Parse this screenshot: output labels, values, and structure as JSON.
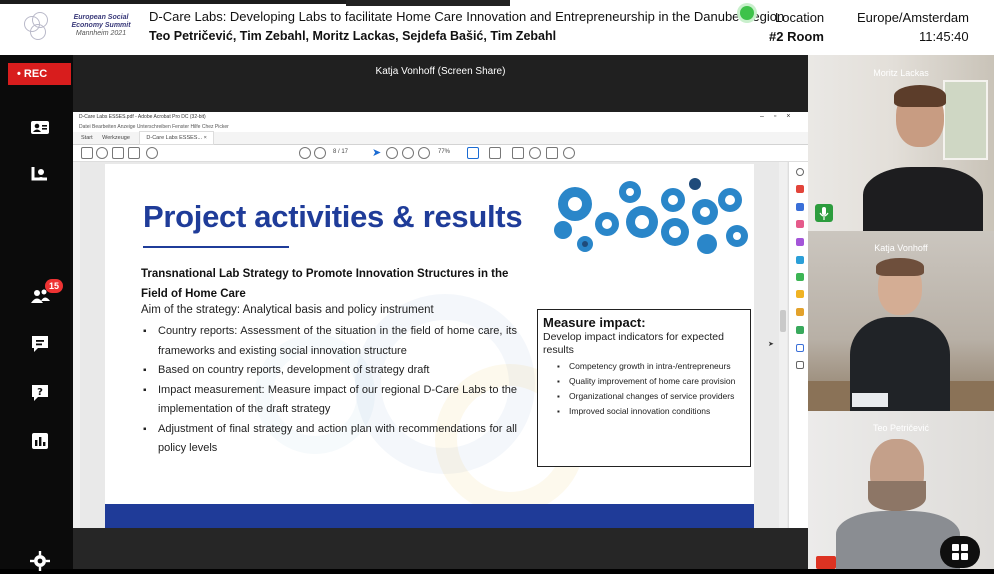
{
  "header": {
    "logo_text_line1": "European Social",
    "logo_text_line2": "Economy Summit",
    "logo_text_line3": "Mannheim 2021",
    "session_title": "D-Care Labs: Developing Labs to facilitate Home Care Innovation and Entrepreneurship in the Danube Region",
    "speakers": "Teo Petričević, Tim Zebahl, Moritz Lackas, Sejdefa Bašić, Tim Zebahl",
    "location_label": "Location",
    "location_value": "#2 Room",
    "timezone_label": "Europe/Amsterdam",
    "time_value": "11:45:40",
    "status_color": "#3ec24a"
  },
  "sidebar": {
    "rec_label": "• REC",
    "participants_count": "15",
    "items": [
      {
        "icon": "people-screen-icon"
      },
      {
        "icon": "speaker-icon"
      },
      {
        "icon": "participants-icon"
      },
      {
        "icon": "chat-icon"
      },
      {
        "icon": "question-icon"
      },
      {
        "icon": "poll-icon"
      },
      {
        "icon": "settings-icon"
      }
    ]
  },
  "stage": {
    "presenter_label": "Katja Vonhoff (Screen Share)"
  },
  "acrobat": {
    "window_title": "D-Care Labs ESSES.pdf - Adobe Acrobat Pro DC (32-bit)",
    "menu": "Datei   Bearbeiten   Anzeige   Unterschreiben   Fenster   Hilfe   Chez Picker",
    "tab_start": "Start",
    "tab_tools": "Werkzeuge",
    "tab_doc": "D-Care Labs ESSES... ×",
    "page_indicator": "8 / 17",
    "zoom": "77%"
  },
  "slide": {
    "title": "Project activities & results",
    "subheading": "Transnational Lab Strategy to Promote Innovation Structures in the Field of Home Care",
    "aim": "Aim of the strategy: Analytical basis and policy instrument",
    "bullets": [
      "Country reports: Assessment of the situation in the field of home care, its frameworks and existing social innovation structure",
      "Based on country reports, development of strategy draft",
      "Impact measurement: Measure impact of our regional D-Care Labs to the implementation of the draft strategy",
      "Adjustment of final strategy and action plan with recommendations for all policy levels"
    ],
    "measure_title": "Measure impact:",
    "measure_desc": "Develop impact indicators for expected results",
    "measure_items": [
      "Competency growth in intra-/entrepreneurs",
      "Quality improvement of home care provision",
      "Organizational changes of service providers",
      "Improved social innovation conditions"
    ],
    "title_color": "#1f3c99"
  },
  "videos": [
    {
      "name": "Moritz Lackas"
    },
    {
      "name": "Katja Vonhoff"
    },
    {
      "name": "Teo Petričević"
    }
  ]
}
